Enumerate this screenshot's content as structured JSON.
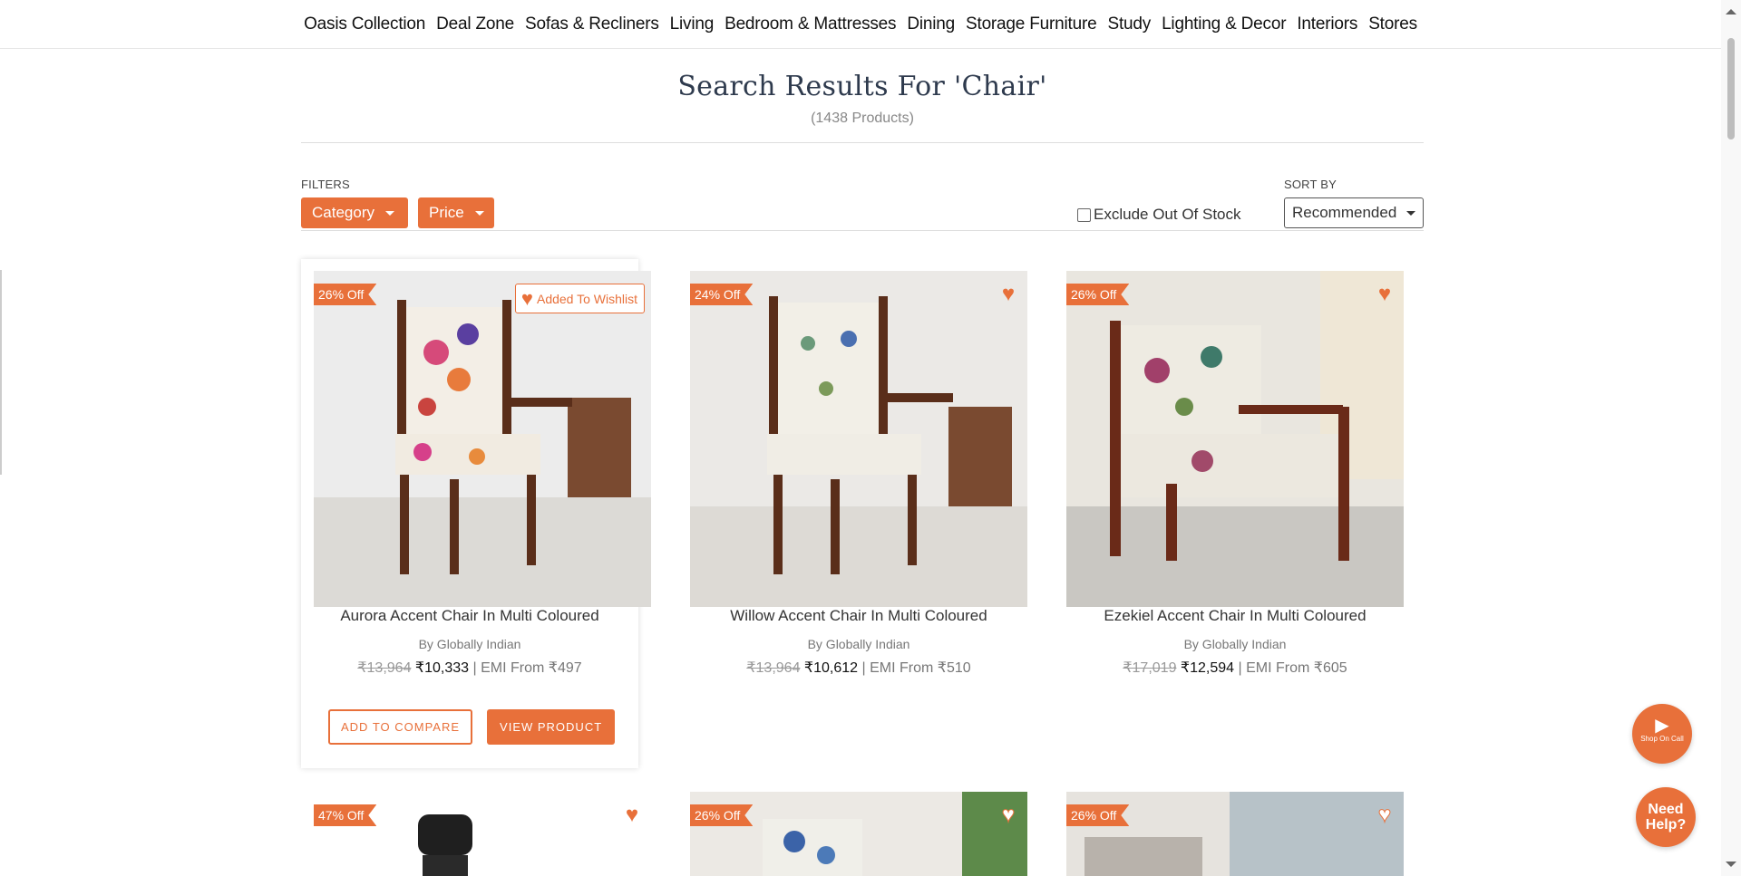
{
  "nav": {
    "items": [
      "Oasis Collection",
      "Deal Zone",
      "Sofas & Recliners",
      "Living",
      "Bedroom & Mattresses",
      "Dining",
      "Storage Furniture",
      "Study",
      "Lighting & Decor",
      "Interiors",
      "Stores"
    ]
  },
  "heading": {
    "title": "Search Results For 'Chair'",
    "count": "(1438 Products)"
  },
  "filters": {
    "label": "FILTERS",
    "category": "Category",
    "price": "Price",
    "exclude_stock": "Exclude Out Of Stock",
    "sort_label": "SORT BY",
    "sort_value": "Recommended"
  },
  "products": [
    {
      "discount": "26% Off",
      "title": "Aurora Accent Chair In Multi Coloured",
      "brand": "By Globally Indian",
      "mrp": "₹13,964",
      "price": "₹10,333",
      "emi": "| EMI From ₹497",
      "wishlist": "Added To Wishlist"
    },
    {
      "discount": "24% Off",
      "title": "Willow Accent Chair In Multi Coloured",
      "brand": "By Globally Indian",
      "mrp": "₹13,964",
      "price": "₹10,612",
      "emi": "| EMI From ₹510"
    },
    {
      "discount": "26% Off",
      "title": "Ezekiel Accent Chair In Multi Coloured",
      "brand": "By Globally Indian",
      "mrp": "₹17,019",
      "price": "₹12,594",
      "emi": "| EMI From ₹605"
    },
    {
      "discount": "47% Off"
    },
    {
      "discount": "26% Off"
    },
    {
      "discount": "26% Off"
    }
  ],
  "card_actions": {
    "compare": "ADD TO COMPARE",
    "view": "VIEW PRODUCT"
  },
  "floating": {
    "shop_on_call": "Shop On Call",
    "need_help_1": "Need",
    "need_help_2": "Help?"
  },
  "colors": {
    "accent": "#e8703a",
    "heading": "#2e3a4d"
  }
}
